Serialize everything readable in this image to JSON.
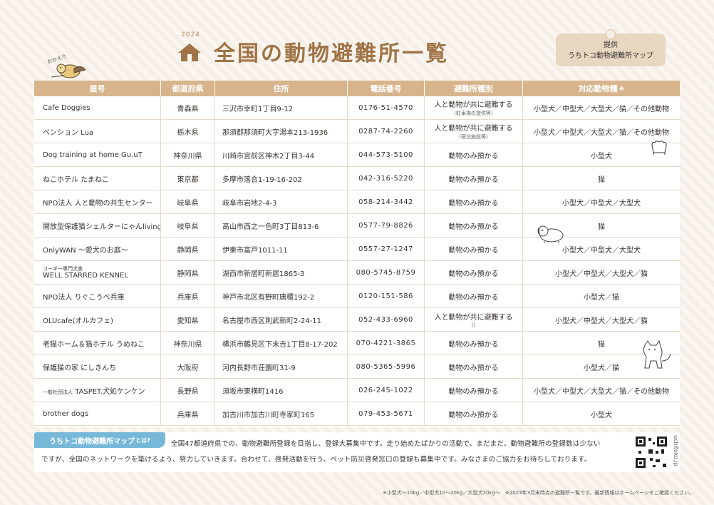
{
  "header": {
    "year": "2024",
    "title": "全国の動物避難所一覧",
    "provider_line1": "提供",
    "provider_line2": "うちトコ動物避難所マップ",
    "bird_label": "おかえり"
  },
  "table": {
    "columns": [
      "屋号",
      "都道府県",
      "住所",
      "電話番号",
      "避難所種別",
      "対応動物種"
    ],
    "columns_note": "※",
    "rows": [
      {
        "name": "Cafe Doggies",
        "pref": "青森県",
        "addr": "三沢市幸町1丁目9-12",
        "tel": "0176-51-4570",
        "type": "人と動物が共に避難する",
        "type_sub": "(駐車場の提供等)",
        "species": "小型犬／中型犬／大型犬／猫／その他動物"
      },
      {
        "name": "ペンション Lua",
        "pref": "栃木県",
        "addr": "那須郡那須町大字湯本213-1936",
        "tel": "0287-74-2260",
        "type": "人と動物が共に避難する",
        "type_sub": "(宿泊施設等)",
        "species": "小型犬／中型犬／大型犬／猫／その他動物"
      },
      {
        "name": "Dog training at home Gu.uT",
        "pref": "神奈川県",
        "addr": "川崎市宮前区神木2丁目3-44",
        "tel": "044-573-5100",
        "type": "動物のみ預かる",
        "type_sub": "",
        "species": "小型犬"
      },
      {
        "name": "ねこホテル たまねこ",
        "pref": "東京都",
        "addr": "多摩市落合1-19-16-202",
        "tel": "042-316-5220",
        "type": "動物のみ預かる",
        "type_sub": "",
        "species": "猫"
      },
      {
        "name": "NPO法人 人と動物の共生センター",
        "pref": "岐阜県",
        "addr": "岐阜市岩地2-4-3",
        "tel": "058-214-3442",
        "type": "動物のみ預かる",
        "type_sub": "",
        "species": "小型犬／中型犬／大型犬"
      },
      {
        "name": "開放型保護猫シェルターにゃんliving",
        "pref": "岐阜県",
        "addr": "高山市西之一色町3丁目813-6",
        "tel": "0577-79-8826",
        "type": "動物のみ預かる",
        "type_sub": "",
        "species": "猫"
      },
      {
        "name": "OnlyWAN 〜愛犬のお庭〜",
        "pref": "静岡県",
        "addr": "伊東市富戸1011-11",
        "tel": "0557-27-1247",
        "type": "動物のみ預かる",
        "type_sub": "",
        "species": "小型犬／中型犬／大型犬"
      },
      {
        "name": "WELL STARRED KENNEL",
        "name_tag": "コーギー専門犬舎",
        "pref": "静岡県",
        "addr": "湖西市新居町新居1865-3",
        "tel": "080-5745-8759",
        "type": "動物のみ預かる",
        "type_sub": "",
        "species": "小型犬／中型犬／大型犬／猫"
      },
      {
        "name": "NPO法人 りぐこうべ兵庫",
        "pref": "兵庫県",
        "addr": "神戸市北区有野町唐櫃192-2",
        "tel": "0120-151-586",
        "type": "動物のみ預かる",
        "type_sub": "",
        "species": "小型犬／猫"
      },
      {
        "name": "OLUcafe(オルカフェ)",
        "pref": "愛知県",
        "addr": "名古屋市西区則武新町2-24-11",
        "tel": "052-433-6960",
        "type": "人と動物が共に避難する",
        "type_sub": "()",
        "species": "小型犬／中型犬／大型犬／猫"
      },
      {
        "name": "老猫ホーム＆猫ホテル うめねこ",
        "pref": "神奈川県",
        "addr": "横浜市鶴見区下末吉1丁目8-17-202",
        "tel": "070-4221-3865",
        "type": "動物のみ預かる",
        "type_sub": "",
        "species": "猫"
      },
      {
        "name": "保護猫の家 にしきんち",
        "pref": "大阪府",
        "addr": "河内長野市荘園町31-9",
        "tel": "080-5365-5996",
        "type": "動物のみ預かる",
        "type_sub": "",
        "species": "小型犬／猫"
      },
      {
        "name": "TASPET.犬処ケンケン",
        "name_prefix": "一般社団法人",
        "pref": "長野県",
        "addr": "須坂市東横町1416",
        "tel": "026-245-1022",
        "type": "動物のみ預かる",
        "type_sub": "",
        "species": "小型犬／中型犬／大型犬／猫／その他動物"
      },
      {
        "name": "brother dogs",
        "pref": "兵庫県",
        "addr": "加古川市加古川町寺家町165",
        "tel": "079-453-5671",
        "type": "動物のみ預かる",
        "type_sub": "",
        "species": "小型犬"
      }
    ]
  },
  "about": {
    "tag": "うちトコ動物避難所マップ",
    "tag_suffix": "とは?",
    "line1": "全国47都道府県での、動物避難所登録を目指し、登録大募集中です。走り始めたばかりの活動で、まだまだ、動物避難所の登録数は少ない",
    "line2": "ですが、全国のネットワークを築けるよう、努力していきます。合わせて、啓発活動を行う、ペット防災啓発窓口の登録も募集中です。みなさまのご協力をお待ちしております。",
    "site": "uchitoko.jp"
  },
  "footer_note": "※小型犬〜10kg／中型犬10〜20kg／大型犬20kg〜　※2023年3月末時点の避難所一覧です。最新情報はホームページをご確認ください。"
}
